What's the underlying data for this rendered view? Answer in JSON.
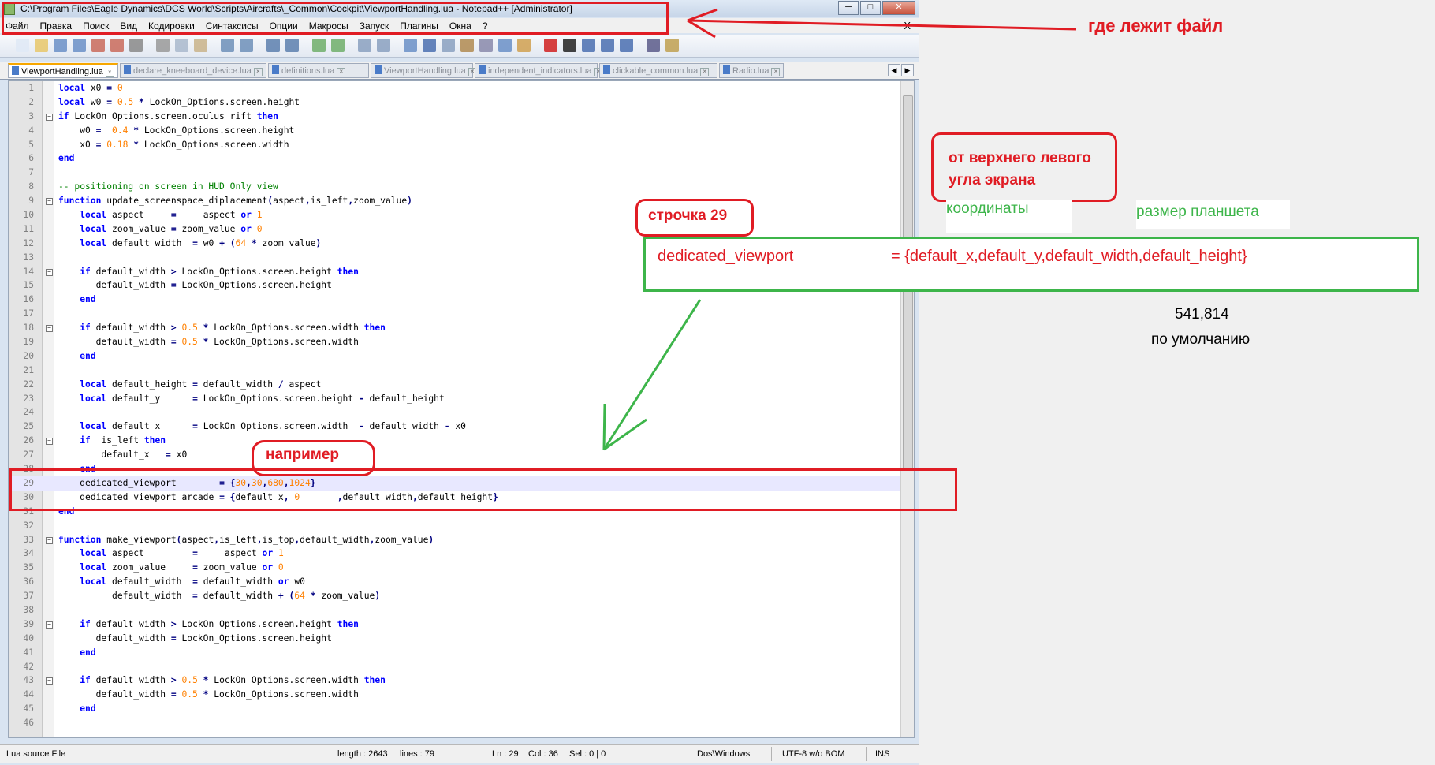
{
  "window": {
    "title": "C:\\Program Files\\Eagle Dynamics\\DCS World\\Scripts\\Aircrafts\\_Common\\Cockpit\\ViewportHandling.lua - Notepad++ [Administrator]",
    "min_label": "─",
    "max_label": "□",
    "close_label": "✕"
  },
  "menu": {
    "items": [
      "Файл",
      "Правка",
      "Поиск",
      "Вид",
      "Кодировки",
      "Синтаксисы",
      "Опции",
      "Макросы",
      "Запуск",
      "Плагины",
      "Окна",
      "?"
    ],
    "close_x": "X"
  },
  "tabs": [
    {
      "label": "ViewportHandling.lua",
      "active": true
    },
    {
      "label": "declare_kneeboard_device.lua",
      "active": false
    },
    {
      "label": "definitions.lua",
      "active": false
    },
    {
      "label": "ViewportHandling.lua",
      "active": false
    },
    {
      "label": "independent_indicators.lua",
      "active": false
    },
    {
      "label": "clickable_common.lua",
      "active": false
    },
    {
      "label": "Radio.lua",
      "active": false
    }
  ],
  "code_lines": [
    {
      "n": "1",
      "t": "local x0 = 0"
    },
    {
      "n": "2",
      "t": "local w0 = 0.5 * LockOn_Options.screen.height"
    },
    {
      "n": "3",
      "t": "if LockOn_Options.screen.oculus_rift then"
    },
    {
      "n": "4",
      "t": "    w0 =  0.4 * LockOn_Options.screen.height"
    },
    {
      "n": "5",
      "t": "    x0 = 0.18 * LockOn_Options.screen.width"
    },
    {
      "n": "6",
      "t": "end"
    },
    {
      "n": "7",
      "t": ""
    },
    {
      "n": "8",
      "t": "-- positioning on screen in HUD Only view"
    },
    {
      "n": "9",
      "t": "function update_screenspace_diplacement(aspect,is_left,zoom_value)"
    },
    {
      "n": "10",
      "t": "    local aspect     =     aspect or 1"
    },
    {
      "n": "11",
      "t": "    local zoom_value = zoom_value or 0"
    },
    {
      "n": "12",
      "t": "    local default_width  = w0 + (64 * zoom_value)"
    },
    {
      "n": "13",
      "t": ""
    },
    {
      "n": "14",
      "t": "    if default_width > LockOn_Options.screen.height then"
    },
    {
      "n": "15",
      "t": "       default_width = LockOn_Options.screen.height"
    },
    {
      "n": "16",
      "t": "    end"
    },
    {
      "n": "17",
      "t": ""
    },
    {
      "n": "18",
      "t": "    if default_width > 0.5 * LockOn_Options.screen.width then"
    },
    {
      "n": "19",
      "t": "       default_width = 0.5 * LockOn_Options.screen.width"
    },
    {
      "n": "20",
      "t": "    end"
    },
    {
      "n": "21",
      "t": ""
    },
    {
      "n": "22",
      "t": "    local default_height = default_width / aspect"
    },
    {
      "n": "23",
      "t": "    local default_y      = LockOn_Options.screen.height - default_height"
    },
    {
      "n": "24",
      "t": ""
    },
    {
      "n": "25",
      "t": "    local default_x      = LockOn_Options.screen.width  - default_width - x0"
    },
    {
      "n": "26",
      "t": "    if  is_left then"
    },
    {
      "n": "27",
      "t": "        default_x   = x0"
    },
    {
      "n": "28",
      "t": "    end"
    },
    {
      "n": "29",
      "t": "    dedicated_viewport        = {30,30,680,1024}"
    },
    {
      "n": "30",
      "t": "    dedicated_viewport_arcade = {default_x, 0       ,default_width,default_height}"
    },
    {
      "n": "31",
      "t": "end"
    },
    {
      "n": "32",
      "t": ""
    },
    {
      "n": "33",
      "t": "function make_viewport(aspect,is_left,is_top,default_width,zoom_value)"
    },
    {
      "n": "34",
      "t": "    local aspect         =     aspect or 1"
    },
    {
      "n": "35",
      "t": "    local zoom_value     = zoom_value or 0"
    },
    {
      "n": "36",
      "t": "    local default_width  = default_width or w0"
    },
    {
      "n": "37",
      "t": "          default_width  = default_width + (64 * zoom_value)"
    },
    {
      "n": "38",
      "t": ""
    },
    {
      "n": "39",
      "t": "    if default_width > LockOn_Options.screen.height then"
    },
    {
      "n": "40",
      "t": "       default_width = LockOn_Options.screen.height"
    },
    {
      "n": "41",
      "t": "    end"
    },
    {
      "n": "42",
      "t": ""
    },
    {
      "n": "43",
      "t": "    if default_width > 0.5 * LockOn_Options.screen.width then"
    },
    {
      "n": "44",
      "t": "       default_width = 0.5 * LockOn_Options.screen.width"
    },
    {
      "n": "45",
      "t": "    end"
    },
    {
      "n": "46",
      "t": ""
    }
  ],
  "status": {
    "file_type": "Lua source File",
    "length": "length : 2643",
    "lines": "lines : 79",
    "ln": "Ln : 29",
    "col": "Col : 36",
    "sel": "Sel : 0 | 0",
    "eol": "Dos\\Windows",
    "encoding": "UTF-8 w/o BOM",
    "mode": "INS"
  },
  "annotations": {
    "file_location": "где лежит файл",
    "top_left_line1": "от верхнего левого",
    "top_left_line2": "угла экрана",
    "line29": "строчка 29",
    "coordinates": "координаты",
    "tablet_size": "размер планшета",
    "viewport_name": "dedicated_viewport",
    "viewport_value": "= {default_x,default_y,default_width,default_height}",
    "default_value": "541,814",
    "default_label": "по умолчанию",
    "example": "например"
  },
  "colors": {
    "annotation_red": "#e01c24",
    "annotation_green": "#3db54a",
    "keyword_blue": "#0000ff",
    "number_orange": "#ff8000",
    "comment_green": "#008000"
  }
}
